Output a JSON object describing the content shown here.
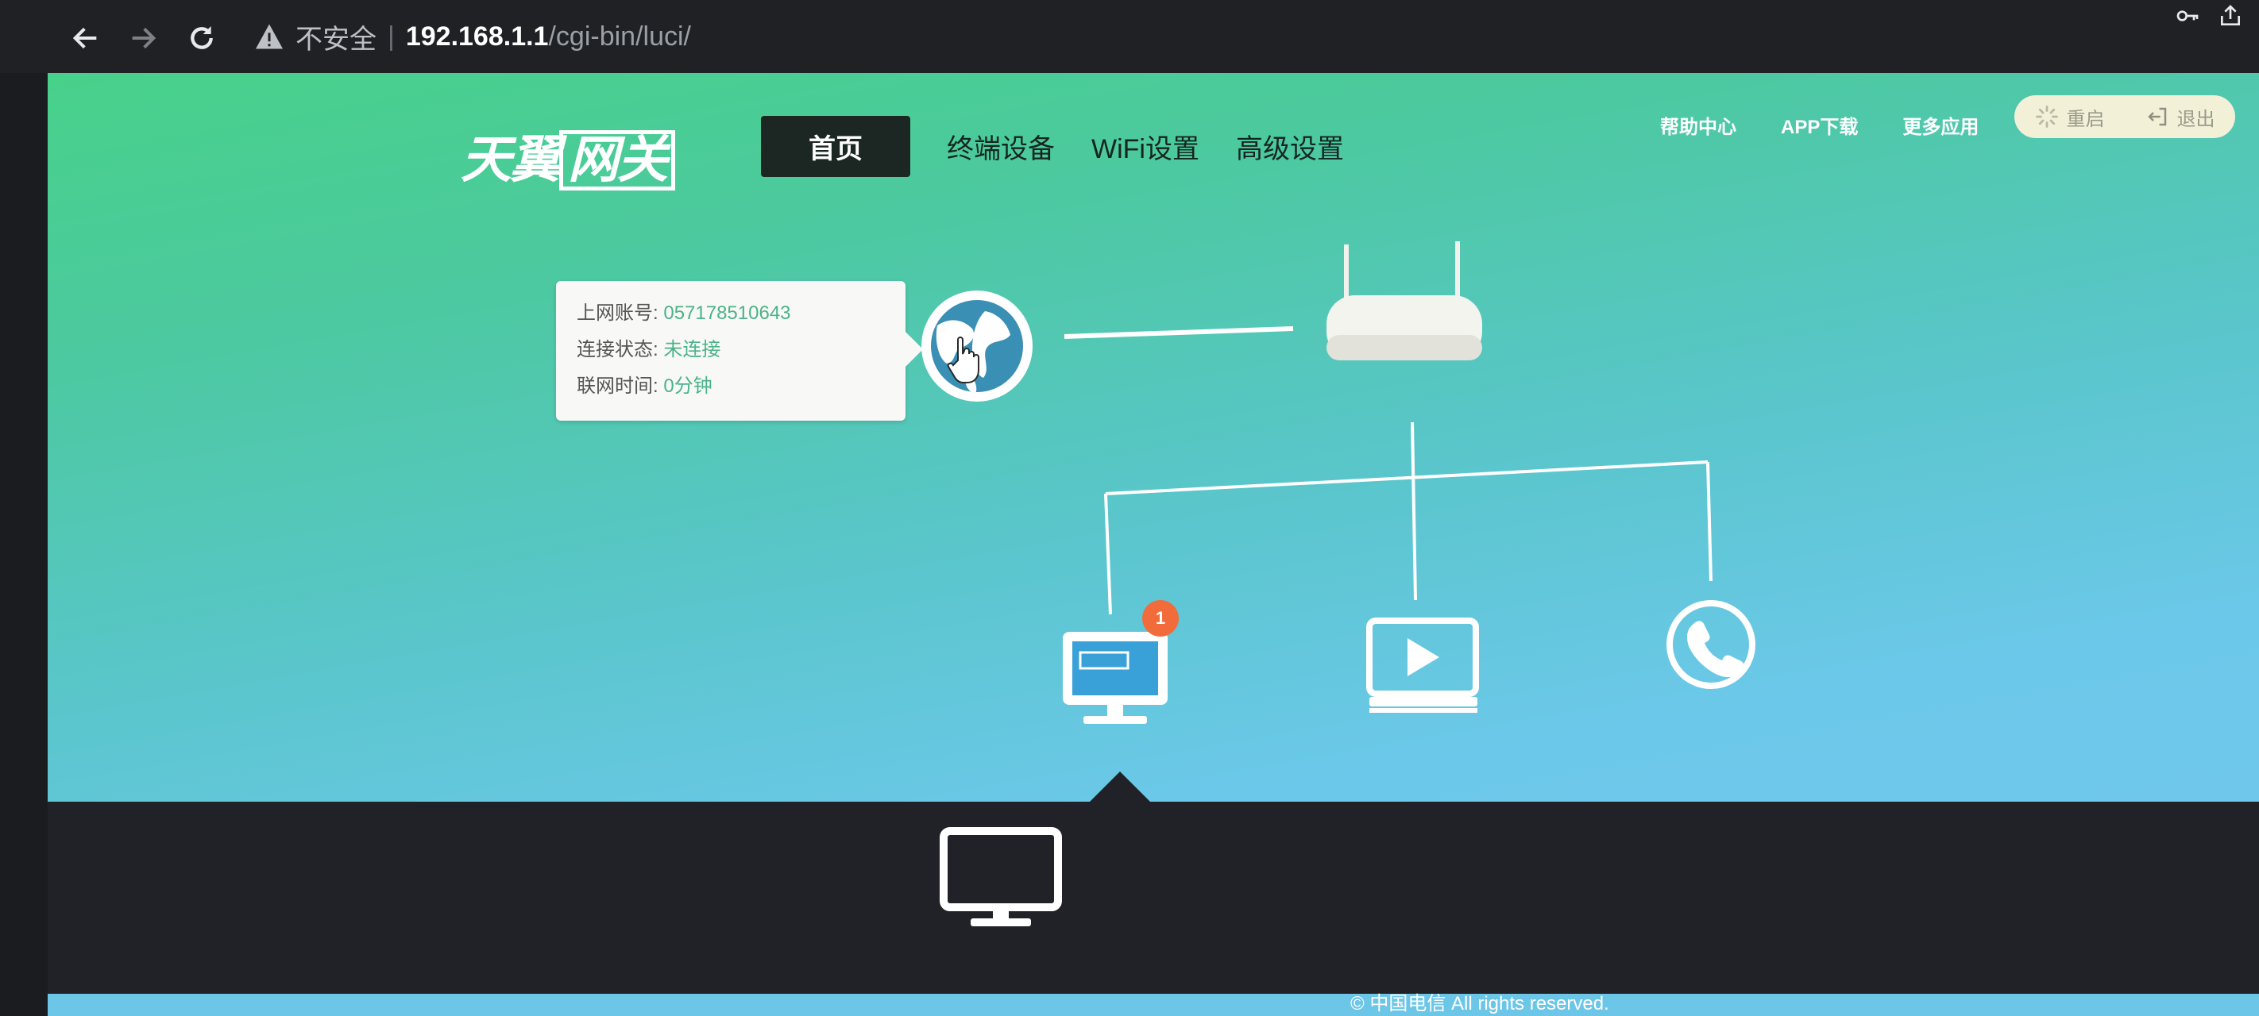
{
  "browser": {
    "insecure_label": "不安全",
    "url_host": "192.168.1.1",
    "url_path": "/cgi-bin/luci/"
  },
  "header": {
    "logo_text_a": "天翼",
    "logo_text_b": "网关",
    "nav": [
      {
        "label": "首页"
      },
      {
        "label": "终端设备"
      },
      {
        "label": "WiFi设置"
      },
      {
        "label": "高级设置"
      }
    ],
    "links": [
      {
        "label": "帮助中心"
      },
      {
        "label": "APP下载"
      },
      {
        "label": "更多应用"
      }
    ],
    "restart_label": "重启",
    "logout_label": "退出"
  },
  "status": {
    "account_label": "上网账号:",
    "account_value": "057178510643",
    "conn_label": "连接状态:",
    "conn_value": "未连接",
    "time_label": "联网时间:",
    "time_value": "0分钟"
  },
  "devices": {
    "pc_badge_count": "1"
  },
  "footer": {
    "copyright": "© 中国电信 All rights reserved."
  },
  "colors": {
    "accent": "#4bb38a",
    "badge": "#f26b3a",
    "dark": "#202228"
  }
}
